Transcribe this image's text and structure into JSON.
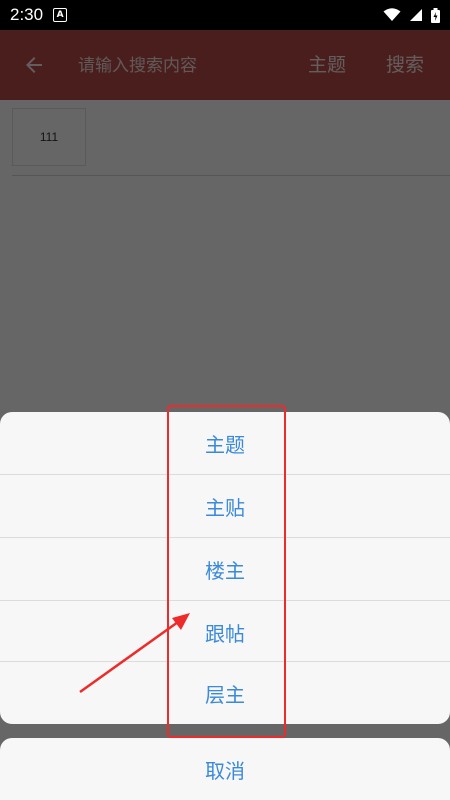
{
  "status_bar": {
    "time": "2:30",
    "app_icon_letter": "A",
    "icons": [
      "wifi-icon",
      "signal-icon",
      "battery-icon"
    ]
  },
  "app_bar": {
    "search_placeholder": "请输入搜索内容",
    "topic_label": "主题",
    "search_label": "搜索",
    "color": "#bb4c4c"
  },
  "content": {
    "chip_text": "111"
  },
  "action_sheet": {
    "items": [
      "主题",
      "主贴",
      "楼主",
      "跟帖",
      "层主"
    ],
    "cancel": "取消",
    "item_color": "#3b8ad9"
  },
  "annotation": {
    "color": "#ee2b2b"
  }
}
